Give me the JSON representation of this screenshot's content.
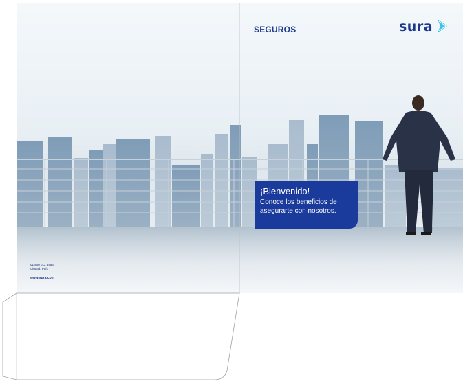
{
  "cover": {
    "brand_label": "SEGUROS",
    "logo_text": "sura",
    "logo_icon": "sura-wing-icon"
  },
  "welcome": {
    "title": "¡Bienvenido!",
    "body_line1": "Conoce los beneficios de",
    "body_line2": "asegurarte con nosotros."
  },
  "back_cover": {
    "phone": "01 800 012 3456",
    "city": "Ciudad, País",
    "website": "www.sura.com"
  },
  "colors": {
    "brand_blue": "#1a3b9c",
    "logo_accent": "#3cc4e6",
    "sky_top": "#eef4f8",
    "floor": "#dfe6ec"
  }
}
